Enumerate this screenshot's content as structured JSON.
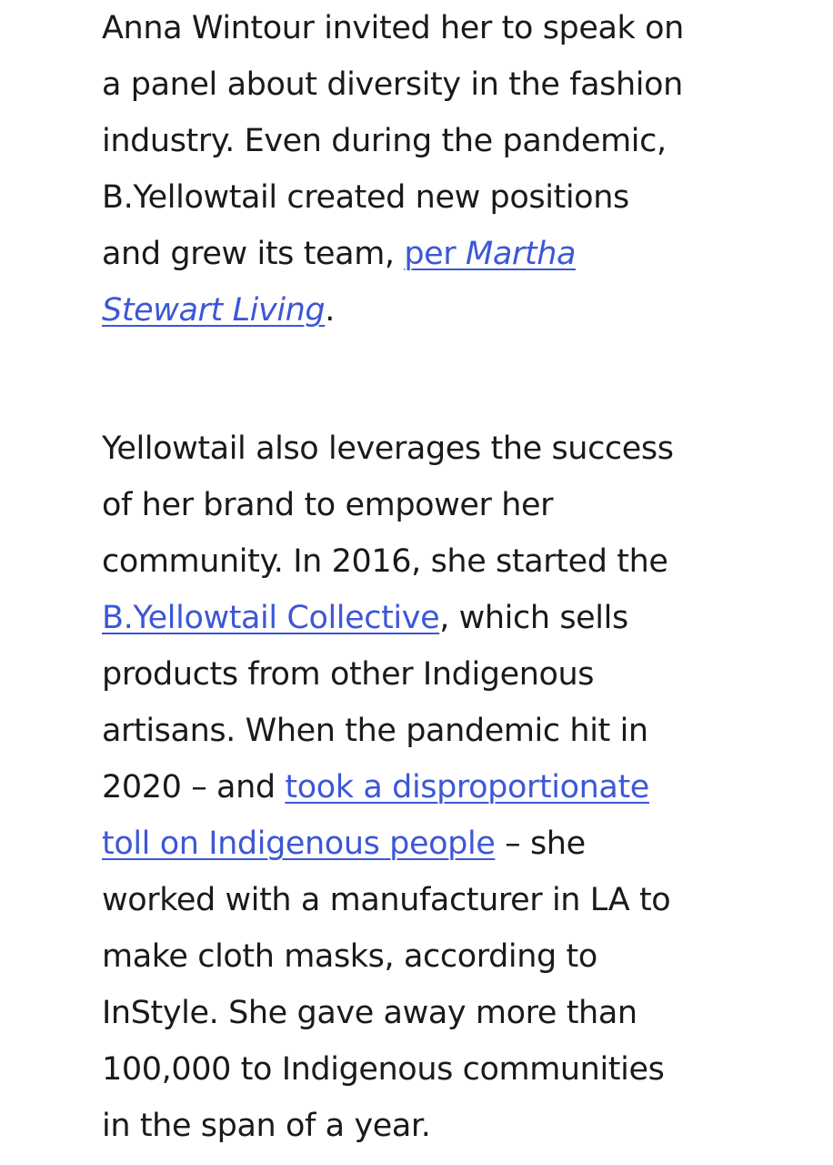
{
  "article": {
    "paragraph_1": {
      "line_1": "Anna Wintour invited her to speak on",
      "line_2": "a panel about diversity in the fashion",
      "line_3": "industry. Even during the pandemic,",
      "line_4": "B.Yellowtail created new positions",
      "line_5_text": "and grew its team, ",
      "line_5_link_plain": "per ",
      "line_5_link_italic": "Martha",
      "line_6_link_italic": "Stewart Living",
      "line_6_end": "."
    },
    "paragraph_2": {
      "line_1": "Yellowtail also leverages the success",
      "line_2": "of her brand to empower her",
      "line_3": "community. In 2016, she started the",
      "line_4_link": "B.Yellowtail Collective",
      "line_4_text": ", which sells",
      "line_5": "products from other Indigenous",
      "line_6": "artisans. When the pandemic hit in",
      "line_7_text": "2020 – and ",
      "line_7_link": "took a disproportionate",
      "line_8_link": "toll on Indigenous people",
      "line_8_text": " – she",
      "line_9": "worked with a manufacturer in LA to",
      "line_10": "make cloth masks, according to",
      "line_11": "InStyle. She gave away more than",
      "line_12": "100,000 to Indigenous communities",
      "line_13": "in the span of a year."
    },
    "link_color": "#3d57d6",
    "text_color": "#1a1a1a"
  }
}
